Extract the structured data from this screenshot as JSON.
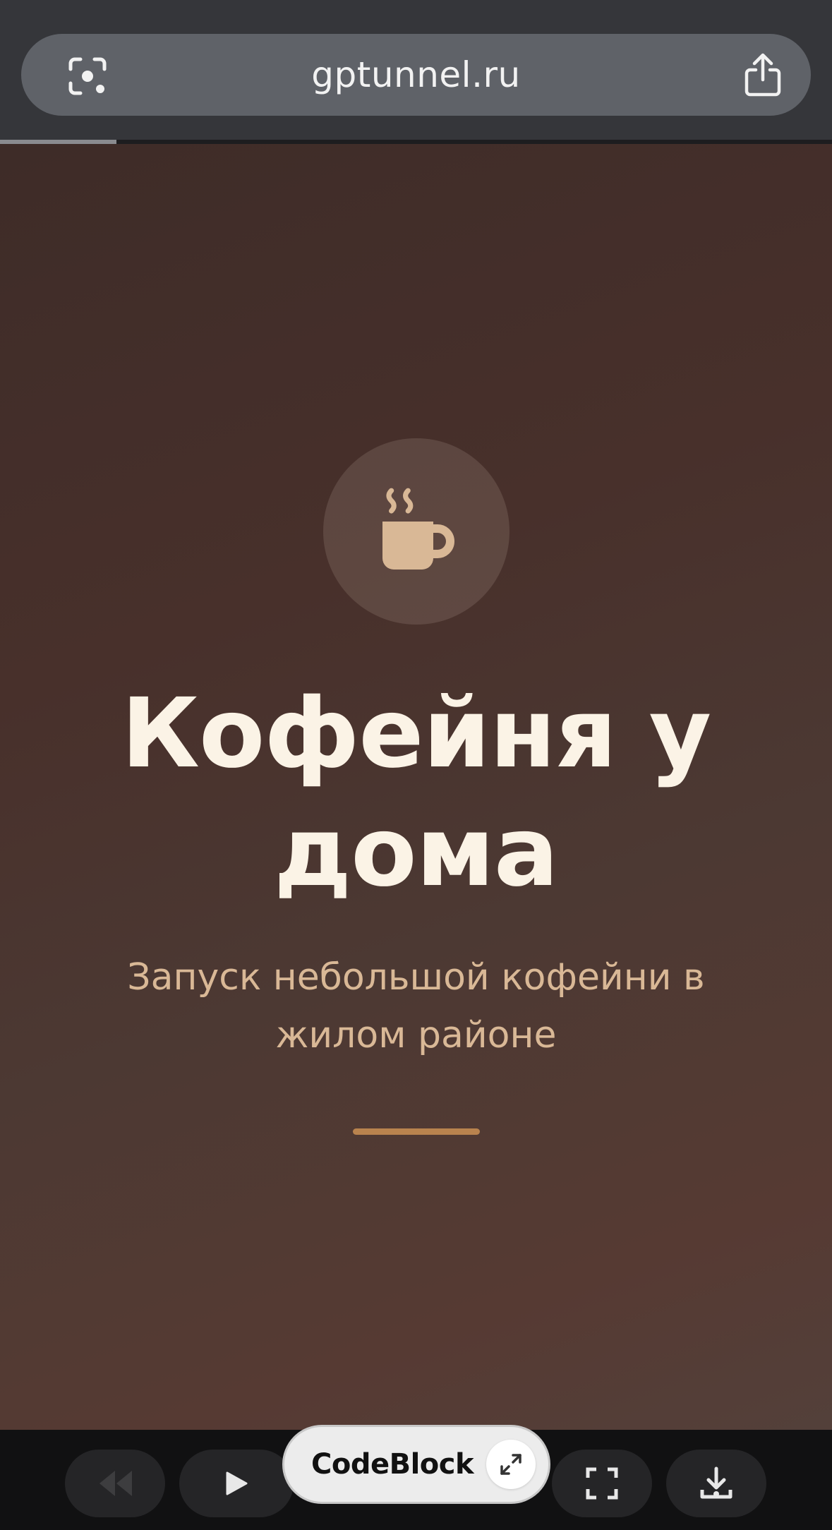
{
  "browser": {
    "url": "gptunnel.ru",
    "page_load_progress": 0.14
  },
  "slide": {
    "icon": "coffee-cup-icon",
    "title": "Кофейня у дома",
    "subtitle": "Запуск небольшой кофейни в жилом районе"
  },
  "player": {
    "controls": [
      "rewind-icon",
      "play-icon",
      "fullscreen-icon",
      "download-icon"
    ],
    "badge_label": "CodeBlock",
    "badge_action": "expand-icon"
  },
  "colors": {
    "title": "#fbf3e6",
    "subtitle": "#d9b896",
    "accent": "#b9834e",
    "cup": "#d9b896"
  }
}
